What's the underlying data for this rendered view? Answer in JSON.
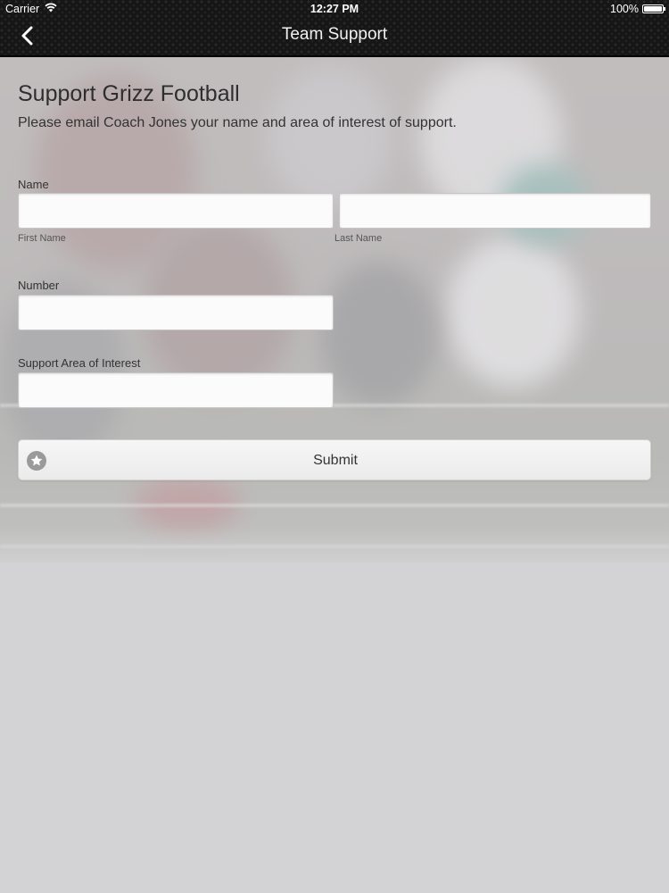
{
  "status_bar": {
    "carrier": "Carrier",
    "time": "12:27 PM",
    "battery": "100%"
  },
  "nav": {
    "title": "Team Support",
    "back_icon": "chevron-left-icon"
  },
  "form": {
    "title": "Support Grizz Football",
    "intro": "Please email Coach Jones your name and area of interest of support.",
    "name_label": "Name",
    "first_name_sublabel": "First Name",
    "last_name_sublabel": "Last Name",
    "first_name_value": "",
    "last_name_value": "",
    "number_label": "Number",
    "number_value": "",
    "interest_label": "Support Area of Interest",
    "interest_value": "",
    "submit_label": "Submit",
    "submit_icon": "star-icon"
  },
  "colors": {
    "nav_background": "#161616",
    "page_background": "#d3d2d4",
    "input_background": "#fbfbfb",
    "button_background": "#efefef"
  }
}
